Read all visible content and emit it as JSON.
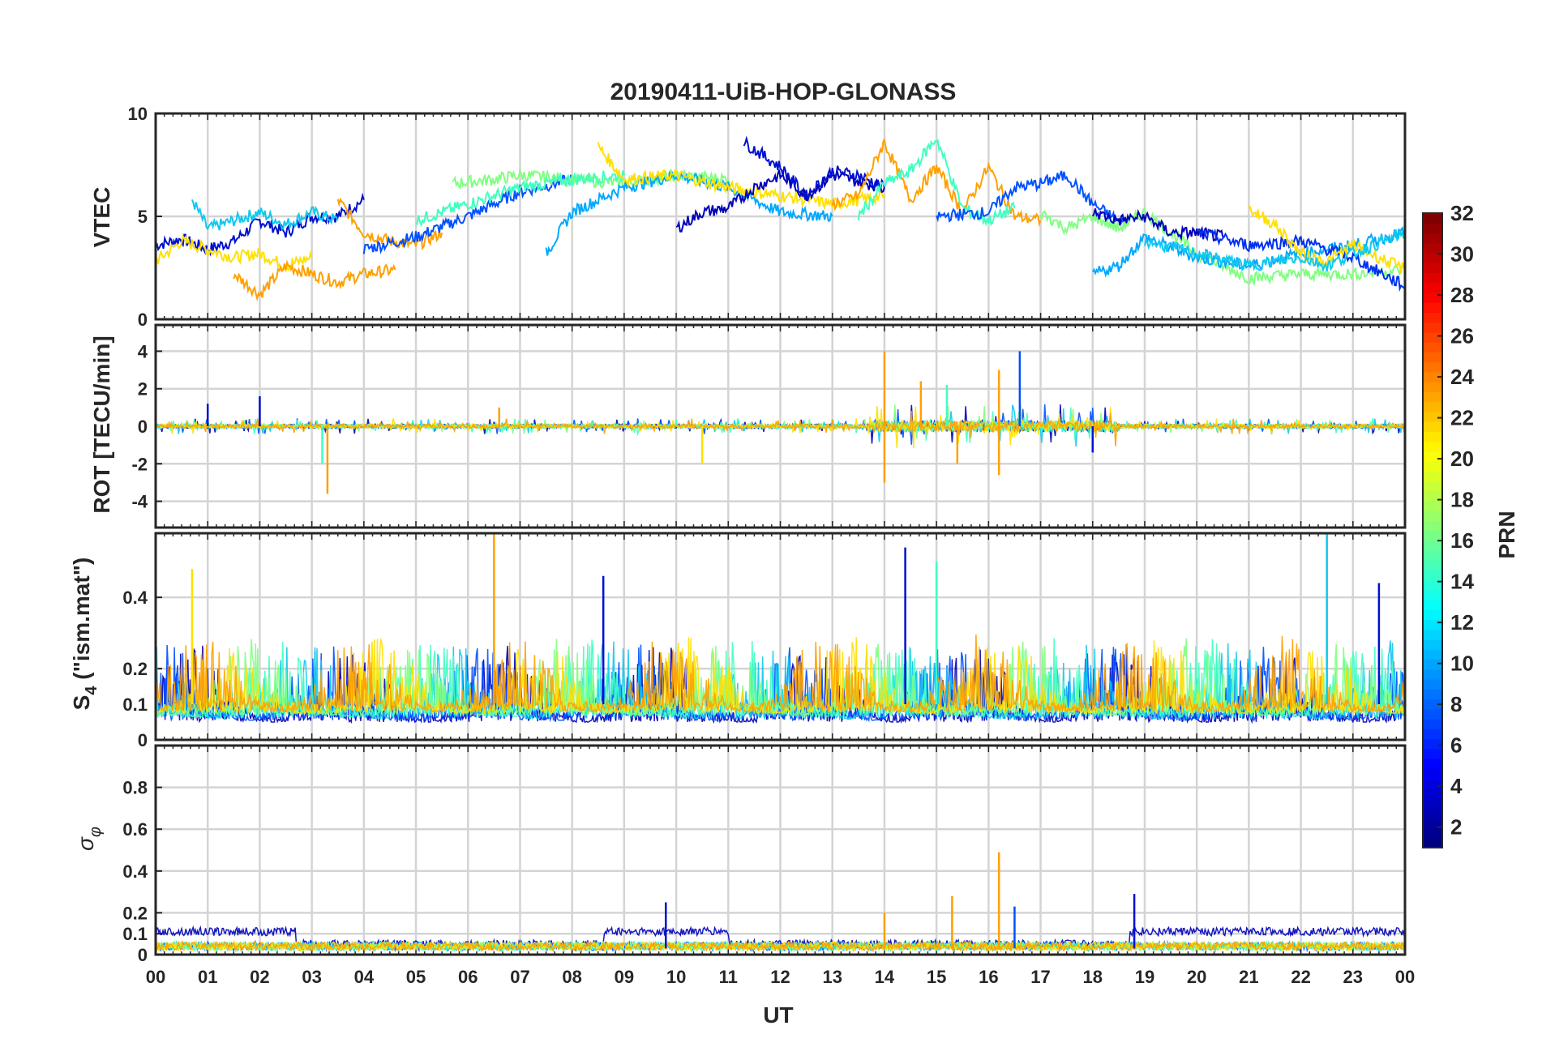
{
  "chart_data": {
    "type": "line",
    "title": "20190411-UiB-HOP-GLONASS",
    "xlabel": "UT",
    "x_ticks": [
      "00",
      "01",
      "02",
      "03",
      "04",
      "05",
      "06",
      "07",
      "08",
      "09",
      "10",
      "11",
      "12",
      "13",
      "14",
      "15",
      "16",
      "17",
      "18",
      "19",
      "20",
      "21",
      "22",
      "23",
      "00"
    ],
    "xlim": [
      0,
      24
    ],
    "grid": true,
    "colorbar": {
      "label": "PRN",
      "colormap": "jet",
      "range": [
        1,
        32
      ],
      "ticks": [
        "2",
        "4",
        "6",
        "8",
        "10",
        "12",
        "14",
        "16",
        "18",
        "20",
        "22",
        "24",
        "26",
        "28",
        "30",
        "32"
      ]
    },
    "panels": [
      {
        "id": "vtec",
        "ylabel": "VTEC",
        "ylim": [
          0,
          10
        ],
        "y_ticks": [
          {
            "v": 0,
            "t": "0"
          },
          {
            "v": 5,
            "t": "5"
          },
          {
            "v": 10,
            "t": "10"
          }
        ],
        "series": [
          {
            "prn": 3,
            "color": "#0010d0",
            "x": [
              0,
              0.5,
              1,
              1.5,
              2,
              2.5,
              3,
              3.5,
              4
            ],
            "y": [
              3.6,
              3.9,
              3.4,
              3.8,
              4.8,
              4.2,
              5.0,
              5.0,
              5.8
            ]
          },
          {
            "prn": 12,
            "color": "#10c8f0",
            "x": [
              0.7,
              1,
              1.5,
              2,
              2.5,
              3,
              3.5
            ],
            "y": [
              5.8,
              4.4,
              4.8,
              5.2,
              4.6,
              5.2,
              4.8
            ]
          },
          {
            "prn": 20,
            "color": "#ffe000",
            "x": [
              0,
              0.5,
              1,
              1.5,
              2,
              2.5,
              3
            ],
            "y": [
              2.8,
              3.8,
              3.4,
              3.0,
              3.2,
              2.6,
              3.0
            ]
          },
          {
            "prn": 22,
            "color": "#ffa000",
            "x": [
              1.5,
              2,
              2.5,
              3,
              3.5,
              4,
              4.6
            ],
            "y": [
              2.2,
              1.2,
              2.6,
              2.2,
              1.8,
              2.2,
              2.4
            ]
          },
          {
            "prn": 22,
            "color": "#ffa000",
            "x": [
              3.5,
              4,
              4.5,
              5,
              5.5
            ],
            "y": [
              5.8,
              4.2,
              3.8,
              3.6,
              4.2
            ]
          },
          {
            "prn": 6,
            "color": "#0050ff",
            "x": [
              4,
              5,
              6,
              7,
              8
            ],
            "y": [
              3.4,
              4.0,
              5.0,
              6.2,
              6.8
            ]
          },
          {
            "prn": 16,
            "color": "#80ff80",
            "x": [
              5.7,
              6.5,
              7,
              8,
              9,
              10,
              11
            ],
            "y": [
              6.6,
              6.8,
              7.0,
              6.8,
              6.6,
              7.0,
              6.8
            ]
          },
          {
            "prn": 14,
            "color": "#40ffc0",
            "x": [
              5,
              6,
              7,
              8,
              9
            ],
            "y": [
              4.8,
              5.6,
              6.4,
              6.8,
              7.0
            ]
          },
          {
            "prn": 10,
            "color": "#00a8ff",
            "x": [
              7.5,
              8,
              9,
              10,
              11,
              12,
              13
            ],
            "y": [
              3.2,
              5.2,
              6.4,
              7.0,
              6.4,
              5.2,
              5.0
            ]
          },
          {
            "prn": 20,
            "color": "#ffe000",
            "x": [
              8.5,
              9,
              10,
              11,
              12,
              13,
              14
            ],
            "y": [
              8.4,
              6.8,
              7.0,
              6.4,
              6.0,
              5.6,
              6.0
            ]
          },
          {
            "prn": 2,
            "color": "#0000b8",
            "x": [
              10,
              10.5,
              11,
              11.5,
              12,
              12.5,
              13,
              14
            ],
            "y": [
              4.4,
              5.2,
              5.4,
              6.4,
              7.0,
              6.0,
              7.0,
              6.4
            ]
          },
          {
            "prn": 3,
            "color": "#0010d0",
            "x": [
              11.3,
              12,
              12.5,
              13,
              13.5,
              14
            ],
            "y": [
              8.6,
              7.4,
              6.0,
              7.2,
              7.0,
              6.4
            ]
          },
          {
            "prn": 22,
            "color": "#ffa000",
            "x": [
              13,
              13.5,
              14,
              14.5,
              15,
              15.5,
              16,
              16.5,
              17
            ],
            "y": [
              5.6,
              6.0,
              8.6,
              5.8,
              7.4,
              5.2,
              7.4,
              5.0,
              4.8
            ]
          },
          {
            "prn": 14,
            "color": "#40ffc0",
            "x": [
              13.5,
              14,
              14.5,
              15,
              15.5,
              16,
              16.5
            ],
            "y": [
              5.0,
              6.6,
              7.2,
              8.8,
              5.4,
              4.8,
              5.4
            ]
          },
          {
            "prn": 6,
            "color": "#0050ff",
            "x": [
              15,
              16,
              16.5,
              17,
              17.5,
              18,
              18.6
            ],
            "y": [
              5.0,
              5.2,
              6.4,
              6.6,
              7.0,
              5.6,
              4.6
            ]
          },
          {
            "prn": 16,
            "color": "#80ff80",
            "x": [
              17,
              17.5,
              18,
              18.5,
              19,
              19.5,
              20,
              21,
              22,
              23,
              24
            ],
            "y": [
              5.2,
              4.4,
              5.0,
              4.4,
              5.2,
              4.2,
              3.2,
              2.0,
              2.2,
              2.2,
              2.4
            ]
          },
          {
            "prn": 2,
            "color": "#0000b8",
            "x": [
              18,
              18.5,
              19,
              19.5,
              20,
              20.5
            ],
            "y": [
              5.2,
              4.8,
              5.0,
              4.2,
              4.2,
              4.0
            ]
          },
          {
            "prn": 10,
            "color": "#00a8ff",
            "x": [
              18,
              18.5,
              19,
              20,
              21,
              22,
              23,
              24
            ],
            "y": [
              2.2,
              2.6,
              4.0,
              3.0,
              2.6,
              3.2,
              3.6,
              4.2
            ]
          },
          {
            "prn": 4,
            "color": "#0030f0",
            "x": [
              20,
              21,
              22,
              23,
              24
            ],
            "y": [
              4.2,
              3.6,
              3.8,
              3.0,
              1.6
            ]
          },
          {
            "prn": 20,
            "color": "#ffe000",
            "x": [
              21,
              21.5,
              22,
              22.5,
              23,
              23.5,
              24
            ],
            "y": [
              5.4,
              4.6,
              3.2,
              2.8,
              3.6,
              3.0,
              2.4
            ]
          },
          {
            "prn": 12,
            "color": "#10c8f0",
            "x": [
              19,
              20,
              21,
              22,
              22.5,
              23,
              24
            ],
            "y": [
              3.8,
              3.2,
              2.6,
              3.0,
              2.6,
              3.2,
              4.2
            ]
          }
        ]
      },
      {
        "id": "rot",
        "ylabel": "ROT [TECU/min]",
        "ylim": [
          -5.4,
          5.4
        ],
        "y_ticks": [
          {
            "v": -4,
            "t": "-4"
          },
          {
            "v": -2,
            "t": "-2"
          },
          {
            "v": 0,
            "t": "0"
          },
          {
            "v": 2,
            "t": "2"
          },
          {
            "v": 4,
            "t": "4"
          }
        ],
        "spikes": [
          {
            "x": 1.0,
            "y": 1.2,
            "color": "#0010d0"
          },
          {
            "x": 2.0,
            "y": 1.6,
            "color": "#0010d0"
          },
          {
            "x": 3.3,
            "y": -3.6,
            "color": "#ffa000"
          },
          {
            "x": 3.2,
            "y": -2.0,
            "color": "#40ffc0"
          },
          {
            "x": 6.6,
            "y": 1.0,
            "color": "#ffa000"
          },
          {
            "x": 10.5,
            "y": -2.0,
            "color": "#ffe000"
          },
          {
            "x": 14.0,
            "y": 4.0,
            "color": "#ffa000"
          },
          {
            "x": 14.0,
            "y": -3.0,
            "color": "#ffa000"
          },
          {
            "x": 14.7,
            "y": 2.4,
            "color": "#ffa000"
          },
          {
            "x": 15.2,
            "y": 2.2,
            "color": "#40ffc0"
          },
          {
            "x": 15.4,
            "y": -2.0,
            "color": "#ffa000"
          },
          {
            "x": 16.2,
            "y": 3.0,
            "color": "#ffa000"
          },
          {
            "x": 16.2,
            "y": -2.6,
            "color": "#ffa000"
          },
          {
            "x": 16.6,
            "y": 4.0,
            "color": "#0050ff"
          },
          {
            "x": 18.0,
            "y": -1.4,
            "color": "#0010d0"
          }
        ]
      },
      {
        "id": "s4",
        "ylabel": "S4 (\"ism.mat\")",
        "ylabel_main": "S",
        "ylabel_sub": "4",
        "ylabel_rest": " (\"ism.mat\")",
        "ylim": [
          0,
          0.58
        ],
        "y_ticks": [
          {
            "v": 0,
            "t": "0"
          },
          {
            "v": 0.1,
            "t": "0.1"
          },
          {
            "v": 0.2,
            "t": "0.2"
          },
          {
            "v": 0.4,
            "t": "0.4"
          }
        ],
        "spikes": [
          {
            "x": 0.7,
            "y": 0.48,
            "color": "#ffe000"
          },
          {
            "x": 6.5,
            "y": 0.58,
            "color": "#ffa000"
          },
          {
            "x": 8.6,
            "y": 0.46,
            "color": "#0010d0"
          },
          {
            "x": 14.4,
            "y": 0.54,
            "color": "#0010d0"
          },
          {
            "x": 15.0,
            "y": 0.5,
            "color": "#40ffc0"
          },
          {
            "x": 22.5,
            "y": 0.58,
            "color": "#10c8f0"
          },
          {
            "x": 23.5,
            "y": 0.44,
            "color": "#0010d0"
          }
        ]
      },
      {
        "id": "sigphi",
        "ylabel": "σφ",
        "ylabel_main": "σ",
        "ylabel_sub": "φ",
        "ylim": [
          0,
          1.0
        ],
        "y_ticks": [
          {
            "v": 0,
            "t": "0"
          },
          {
            "v": 0.1,
            "t": "0.1"
          },
          {
            "v": 0.2,
            "t": "0.2"
          },
          {
            "v": 0.4,
            "t": "0.4"
          },
          {
            "v": 0.6,
            "t": "0.6"
          },
          {
            "v": 0.8,
            "t": "0.8"
          }
        ],
        "spikes": [
          {
            "x": 9.8,
            "y": 0.25,
            "color": "#0010d0"
          },
          {
            "x": 14.0,
            "y": 0.2,
            "color": "#ffa000"
          },
          {
            "x": 15.3,
            "y": 0.28,
            "color": "#ffa000"
          },
          {
            "x": 16.2,
            "y": 0.49,
            "color": "#ffa000"
          },
          {
            "x": 16.5,
            "y": 0.23,
            "color": "#0050ff"
          },
          {
            "x": 18.8,
            "y": 0.29,
            "color": "#0010d0"
          }
        ]
      }
    ]
  }
}
